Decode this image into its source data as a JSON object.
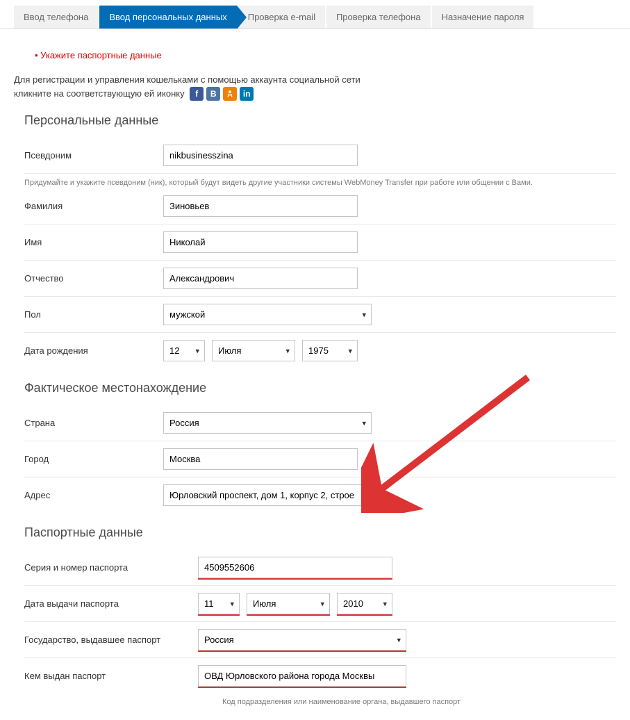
{
  "tabs": [
    "Ввод телефона",
    "Ввод персональных данных",
    "Проверка e-mail",
    "Проверка телефона",
    "Назначение пароля"
  ],
  "activeTab": 1,
  "error": "Укажите паспортные данные",
  "intro1": "Для регистрации и управления кошельками с помощью аккаунта социальной сети",
  "intro2a": "кликните на соответствующую ей иконку",
  "sections": {
    "personal": "Персональные данные",
    "location": "Фактическое местонахождение",
    "passport": "Паспортные данные"
  },
  "labels": {
    "nickname": "Псевдоним",
    "lastname": "Фамилия",
    "firstname": "Имя",
    "patronymic": "Отчество",
    "gender": "Пол",
    "birthdate": "Дата рождения",
    "country": "Страна",
    "city": "Город",
    "address": "Адрес",
    "passportNumber": "Серия и номер паспорта",
    "passportDate": "Дата выдачи паспорта",
    "passportCountry": "Государство, выдавшее паспорт",
    "passportIssuer": "Кем выдан паспорт"
  },
  "values": {
    "nickname": "nikbusinesszina",
    "lastname": "Зиновьев",
    "firstname": "Николай",
    "patronymic": "Александрович",
    "gender": "мужской",
    "birth_day": "12",
    "birth_month": "Июля",
    "birth_year": "1975",
    "country": "Россия",
    "city": "Москва",
    "address": "Юрловский проспект, дом 1, корпус 2, строе",
    "passportNumber": "4509552606",
    "passport_day": "11",
    "passport_month": "Июля",
    "passport_year": "2010",
    "passportCountry": "Россия",
    "passportIssuer": "ОВД Юрловского района города Москвы"
  },
  "notes": {
    "nickname": "Придумайте и укажите псевдоним (ник), который будут видеть другие участники системы WebMoney Transfer при работе или общении с Вами.",
    "passportIssuer": "Код подразделения или наименование органа, выдавшего паспорт"
  }
}
